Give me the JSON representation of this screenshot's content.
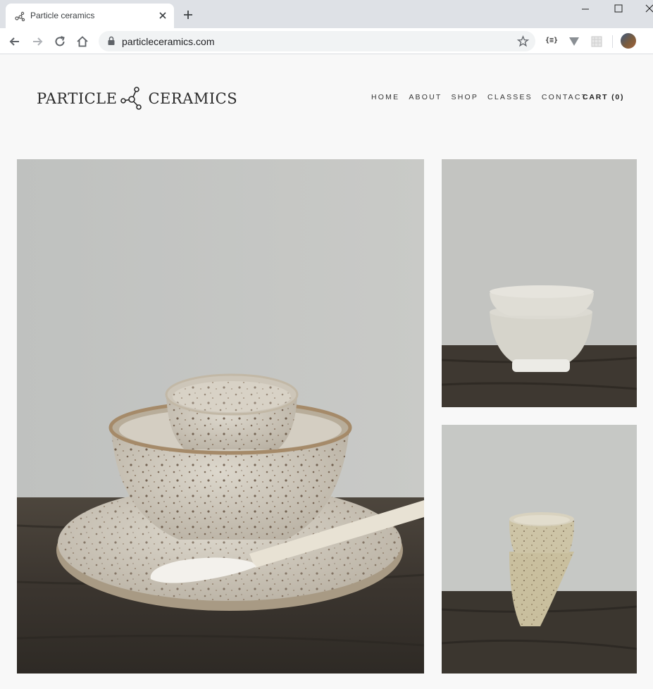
{
  "browser": {
    "tab_title": "Particle ceramics",
    "url": "particleceramics.com",
    "ext_json_label": "{≡}"
  },
  "site": {
    "logo_left": "PARTICLE",
    "logo_right": "CERAMICS",
    "nav": [
      {
        "label": "HOME"
      },
      {
        "label": "ABOUT"
      },
      {
        "label": "SHOP"
      },
      {
        "label": "CLASSES"
      },
      {
        "label": "CONTACT"
      }
    ],
    "cart_label": "CART (0)"
  },
  "colors": {
    "page_bg": "#f8f8f8",
    "text": "#333333"
  }
}
